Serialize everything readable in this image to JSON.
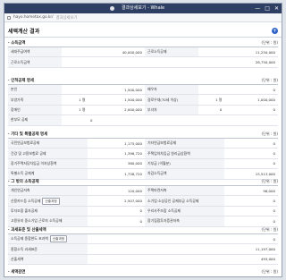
{
  "window": {
    "title": "결과상세보기 - Whale",
    "controls": [
      "—",
      "□",
      "✕"
    ]
  },
  "address": {
    "url": "hayo.hometax.go.kr/",
    "page": "결과상세보기"
  },
  "header": {
    "title": "세액계산 결과",
    "plus": "+"
  },
  "sections": {
    "s1": {
      "title": "· 소득금액",
      "unit": "(단위 : 원)",
      "rows": [
        [
          "세대주급여액",
          "40,000,000",
          "근로소득공제",
          "11,250,000"
        ],
        [
          "근로소득금액",
          "",
          "",
          "28,750,000"
        ]
      ]
    },
    "s2": {
      "title": "· 인적공제 명세",
      "unit": "(단위 : 원)",
      "rows": [
        [
          "본인",
          "1,500,000",
          "배우자",
          "0"
        ],
        [
          "부양가족",
          "1 명",
          "1,500,000",
          "경로우대(70세 이상)",
          "1 명",
          "1,000,000"
        ],
        [
          "장애인",
          "1 명",
          "2,000,000",
          "부녀자",
          "0",
          "0"
        ],
        [
          "한부모 공제",
          "0",
          "",
          ""
        ]
      ]
    },
    "s3": {
      "title": "· 기타 및 특별공제 명세",
      "unit": "(단위 : 원)",
      "rows": [
        [
          "국민연금보험료공제",
          "1,175,000",
          "기타연금보험료공제",
          "0"
        ],
        [
          "건강 및 고용보험료 공제",
          "1,398,720",
          "주택임차차입금 원리금상환액",
          "0"
        ],
        [
          "장기주택저당차입금 이자상환액",
          "360,000",
          "기부금 (이월분)",
          "0"
        ],
        [
          "특별소득 공제계",
          "1,758,720",
          "차감소득금액",
          "15,513,000"
        ]
      ]
    },
    "s4": {
      "title": "· 그 밖의 소득공제",
      "unit": "(단위 : 원)",
      "rows": [
        [
          "개인연금저축",
          "120,000",
          "주택마련저축",
          "96,000"
        ],
        [
          "신용카드등 소득공제",
          "산출과정",
          "2,507,000",
          "소기업·소상공인 공제부금 소득공제",
          "0"
        ],
        [
          "투자조합 출자공제",
          "0",
          "우리사주조합 소득공제",
          "0"
        ],
        [
          "고용유지 중소기업 근로자 소득공제",
          "0",
          "장기집합투자증권저축",
          "0"
        ]
      ]
    },
    "s5": {
      "title": "· 과세표준 및 산출세액",
      "unit": "(단위 : 원)",
      "rows": [
        [
          "소득공제 종합한도 초과액",
          "산출과정",
          "0"
        ],
        [
          "종합소득 과세표준",
          "11,197,000"
        ],
        [
          "산출세액",
          "493,000"
        ]
      ]
    },
    "s6": {
      "title": "· 세액감면",
      "unit": "(단위 : 원)"
    }
  }
}
